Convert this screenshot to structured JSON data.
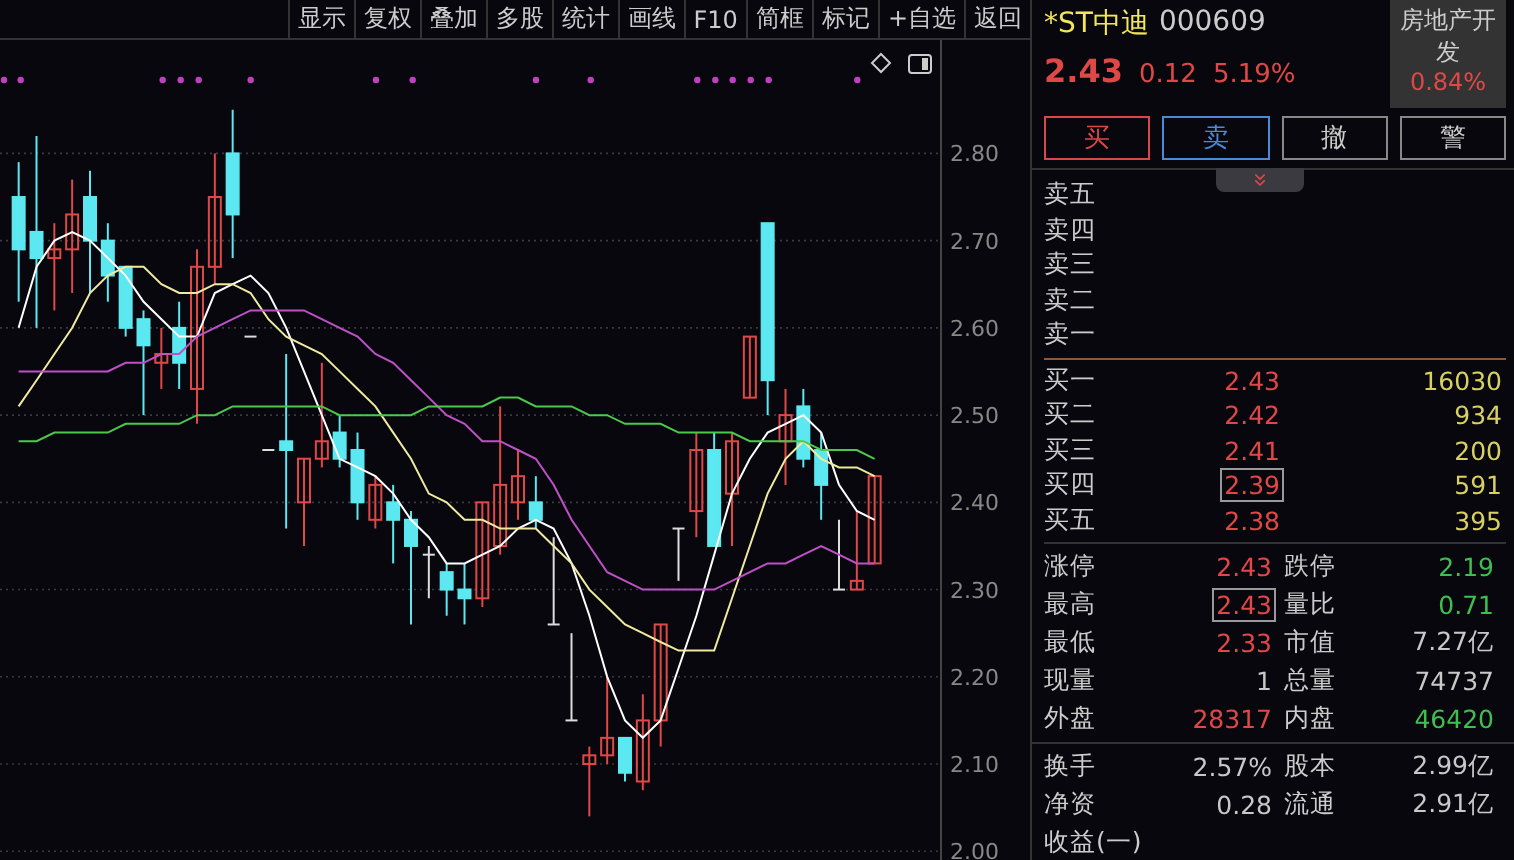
{
  "toolbar": [
    "显示",
    "复权",
    "叠加",
    "多股",
    "统计",
    "画线",
    "F10",
    "简框",
    "标记",
    "+自选",
    "返回"
  ],
  "chart": {
    "chart_data": {
      "type": "candlestick",
      "ylim": [
        1.99,
        2.93
      ],
      "grid": true,
      "yticks": [
        {
          "value": 2.8,
          "label": "2.80"
        },
        {
          "value": 2.7,
          "label": "2.70"
        },
        {
          "value": 2.6,
          "label": "2.60"
        },
        {
          "value": 2.5,
          "label": "2.50"
        },
        {
          "value": 2.4,
          "label": "2.40"
        },
        {
          "value": 2.3,
          "label": "2.30"
        },
        {
          "value": 2.2,
          "label": "2.20"
        },
        {
          "value": 2.1,
          "label": "2.10"
        },
        {
          "value": 2.0,
          "label": "2.00"
        }
      ],
      "ohlc": [
        [
          2.75,
          2.79,
          2.63,
          2.69
        ],
        [
          2.71,
          2.82,
          2.6,
          2.68
        ],
        [
          2.68,
          2.72,
          2.62,
          2.69
        ],
        [
          2.69,
          2.77,
          2.64,
          2.73
        ],
        [
          2.75,
          2.78,
          2.64,
          2.7
        ],
        [
          2.7,
          2.72,
          2.63,
          2.66
        ],
        [
          2.67,
          2.67,
          2.59,
          2.6
        ],
        [
          2.61,
          2.62,
          2.5,
          2.58
        ],
        [
          2.56,
          2.6,
          2.53,
          2.57
        ],
        [
          2.6,
          2.63,
          2.53,
          2.56
        ],
        [
          2.53,
          2.69,
          2.49,
          2.67
        ],
        [
          2.67,
          2.8,
          2.65,
          2.75
        ],
        [
          2.8,
          2.85,
          2.68,
          2.73
        ],
        [
          2.59,
          2.59,
          2.59,
          2.59
        ],
        [
          2.46,
          2.46,
          2.46,
          2.46
        ],
        [
          2.47,
          2.57,
          2.37,
          2.46
        ],
        [
          2.4,
          2.45,
          2.35,
          2.45
        ],
        [
          2.45,
          2.56,
          2.44,
          2.47
        ],
        [
          2.48,
          2.5,
          2.44,
          2.45
        ],
        [
          2.46,
          2.48,
          2.38,
          2.4
        ],
        [
          2.38,
          2.43,
          2.37,
          2.42
        ],
        [
          2.4,
          2.42,
          2.33,
          2.38
        ],
        [
          2.38,
          2.39,
          2.26,
          2.35
        ],
        [
          2.34,
          2.35,
          2.29,
          2.34
        ],
        [
          2.32,
          2.33,
          2.27,
          2.3
        ],
        [
          2.3,
          2.33,
          2.26,
          2.29
        ],
        [
          2.29,
          2.4,
          2.28,
          2.4
        ],
        [
          2.35,
          2.51,
          2.34,
          2.42
        ],
        [
          2.4,
          2.46,
          2.38,
          2.43
        ],
        [
          2.4,
          2.43,
          2.37,
          2.38
        ],
        [
          2.26,
          2.36,
          2.26,
          2.26
        ],
        [
          2.15,
          2.25,
          2.15,
          2.15
        ],
        [
          2.1,
          2.12,
          2.04,
          2.11
        ],
        [
          2.11,
          2.2,
          2.1,
          2.13
        ],
        [
          2.13,
          2.13,
          2.08,
          2.09
        ],
        [
          2.08,
          2.18,
          2.07,
          2.15
        ],
        [
          2.15,
          2.26,
          2.12,
          2.26
        ],
        [
          2.37,
          2.37,
          2.31,
          2.37
        ],
        [
          2.39,
          2.48,
          2.36,
          2.46
        ],
        [
          2.46,
          2.48,
          2.35,
          2.35
        ],
        [
          2.41,
          2.48,
          2.35,
          2.47
        ],
        [
          2.52,
          2.59,
          2.52,
          2.59
        ],
        [
          2.72,
          2.72,
          2.5,
          2.54
        ],
        [
          2.47,
          2.53,
          2.42,
          2.5
        ],
        [
          2.51,
          2.53,
          2.44,
          2.45
        ],
        [
          2.46,
          2.48,
          2.38,
          2.42
        ],
        [
          2.3,
          2.38,
          2.3,
          2.3
        ],
        [
          2.3,
          2.39,
          2.3,
          2.31
        ],
        [
          2.33,
          2.43,
          2.33,
          2.43
        ]
      ],
      "series": [
        {
          "type": "line",
          "color": "#ffffff",
          "values": [
            2.6,
            2.67,
            2.7,
            2.71,
            2.7,
            2.68,
            2.66,
            2.63,
            2.61,
            2.59,
            2.59,
            2.64,
            2.65,
            2.66,
            2.64,
            2.6,
            2.55,
            2.5,
            2.45,
            2.44,
            2.43,
            2.41,
            2.38,
            2.36,
            2.33,
            2.33,
            2.34,
            2.35,
            2.37,
            2.38,
            2.37,
            2.33,
            2.27,
            2.2,
            2.15,
            2.13,
            2.15,
            2.21,
            2.27,
            2.34,
            2.41,
            2.45,
            2.48,
            2.49,
            2.5,
            2.48,
            2.42,
            2.39,
            2.38
          ]
        },
        {
          "type": "line",
          "color": "#f0eaa0",
          "values": [
            2.51,
            2.54,
            2.57,
            2.6,
            2.64,
            2.66,
            2.67,
            2.67,
            2.65,
            2.64,
            2.64,
            2.65,
            2.65,
            2.64,
            2.61,
            2.59,
            2.58,
            2.57,
            2.55,
            2.53,
            2.51,
            2.48,
            2.45,
            2.41,
            2.4,
            2.38,
            2.38,
            2.37,
            2.37,
            2.37,
            2.35,
            2.33,
            2.3,
            2.28,
            2.26,
            2.25,
            2.24,
            2.23,
            2.23,
            2.23,
            2.29,
            2.35,
            2.41,
            2.45,
            2.47,
            2.45,
            2.44,
            2.44,
            2.43
          ]
        },
        {
          "type": "line",
          "color": "#c050c8",
          "values": [
            2.55,
            2.55,
            2.55,
            2.55,
            2.55,
            2.55,
            2.56,
            2.56,
            2.57,
            2.57,
            2.59,
            2.6,
            2.61,
            2.62,
            2.62,
            2.62,
            2.62,
            2.61,
            2.6,
            2.59,
            2.57,
            2.56,
            2.54,
            2.52,
            2.5,
            2.49,
            2.47,
            2.47,
            2.46,
            2.45,
            2.42,
            2.38,
            2.35,
            2.32,
            2.31,
            2.3,
            2.3,
            2.3,
            2.3,
            2.3,
            2.31,
            2.32,
            2.33,
            2.33,
            2.34,
            2.35,
            2.34,
            2.33,
            2.33
          ]
        },
        {
          "type": "line",
          "color": "#4cc84c",
          "values": [
            2.47,
            2.47,
            2.48,
            2.48,
            2.48,
            2.48,
            2.49,
            2.49,
            2.49,
            2.49,
            2.5,
            2.5,
            2.51,
            2.51,
            2.51,
            2.51,
            2.51,
            2.51,
            2.5,
            2.5,
            2.5,
            2.5,
            2.5,
            2.51,
            2.51,
            2.51,
            2.51,
            2.52,
            2.52,
            2.51,
            2.51,
            2.51,
            2.5,
            2.5,
            2.49,
            2.49,
            2.49,
            2.48,
            2.48,
            2.48,
            2.48,
            2.47,
            2.47,
            2.47,
            2.47,
            2.46,
            2.46,
            2.46,
            2.45
          ]
        }
      ]
    }
  },
  "quote": {
    "name": "*ST中迪",
    "code": "000609",
    "price": "2.43",
    "change": "0.12",
    "change_pct": "5.19%",
    "sector": {
      "name": "房地产开发",
      "change_pct": "0.84%"
    }
  },
  "trade_buttons": [
    {
      "label": "买",
      "kind": "buy"
    },
    {
      "label": "卖",
      "kind": "sell"
    },
    {
      "label": "撤",
      "kind": "plain"
    },
    {
      "label": "警",
      "kind": "plain"
    }
  ],
  "asks": [
    {
      "label": "卖五"
    },
    {
      "label": "卖四"
    },
    {
      "label": "卖三"
    },
    {
      "label": "卖二"
    },
    {
      "label": "卖一"
    }
  ],
  "bids": [
    {
      "label": "买一",
      "price": "2.43",
      "volume": "16030",
      "highlighted": false
    },
    {
      "label": "买二",
      "price": "2.42",
      "volume": "934",
      "highlighted": false
    },
    {
      "label": "买三",
      "price": "2.41",
      "volume": "200",
      "highlighted": false
    },
    {
      "label": "买四",
      "price": "2.39",
      "volume": "591",
      "highlighted": true
    },
    {
      "label": "买五",
      "price": "2.38",
      "volume": "395",
      "highlighted": false
    }
  ],
  "stats_groups": [
    [
      {
        "label": "涨停",
        "value": "2.43",
        "color": "#e04848",
        "highlighted": false
      },
      {
        "label": "跌停",
        "value": "2.19",
        "color": "#3fbf4f",
        "highlighted": false
      },
      {
        "label": "最高",
        "value": "2.43",
        "color": "#e04848",
        "highlighted": true
      },
      {
        "label": "量比",
        "value": "0.71",
        "color": "#3fbf4f",
        "highlighted": false
      },
      {
        "label": "最低",
        "value": "2.33",
        "color": "#e04848",
        "highlighted": false
      },
      {
        "label": "市值",
        "value": "7.27亿",
        "color": "#c8c8c8",
        "highlighted": false
      },
      {
        "label": "现量",
        "value": "1",
        "color": "#c8c8c8",
        "highlighted": false
      },
      {
        "label": "总量",
        "value": "74737",
        "color": "#c8c8c8",
        "highlighted": false
      },
      {
        "label": "外盘",
        "value": "28317",
        "color": "#e04848",
        "highlighted": false
      },
      {
        "label": "内盘",
        "value": "46420",
        "color": "#3fbf4f",
        "highlighted": false
      }
    ],
    [
      {
        "label": "换手",
        "value": "2.57%",
        "color": "#c8c8c8",
        "highlighted": false
      },
      {
        "label": "股本",
        "value": "2.99亿",
        "color": "#c8c8c8",
        "highlighted": false
      },
      {
        "label": "净资",
        "value": "0.28",
        "color": "#c8c8c8",
        "highlighted": false
      },
      {
        "label": "流通",
        "value": "2.91亿",
        "color": "#c8c8c8",
        "highlighted": false
      }
    ]
  ],
  "footer_label": "收益(一)"
}
